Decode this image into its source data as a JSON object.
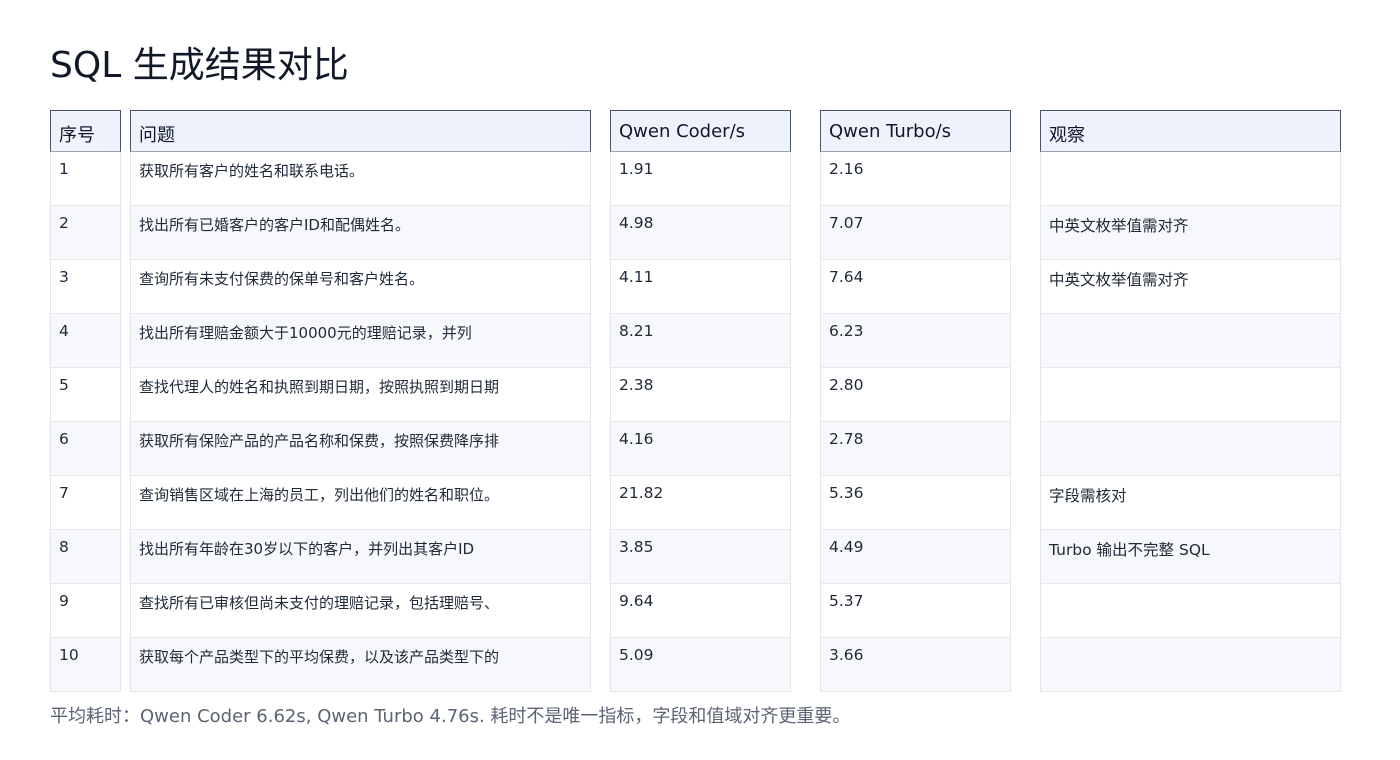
{
  "title": "SQL 生成结果对比",
  "columns": {
    "index": "序号",
    "question": "问题",
    "coder": "Qwen Coder/s",
    "turbo": "Qwen Turbo/s",
    "note": "观察"
  },
  "rows": [
    {
      "index": "1",
      "question": "获取所有客户的姓名和联系电话。",
      "coder": "1.91",
      "turbo": "2.16",
      "note": ""
    },
    {
      "index": "2",
      "question": "找出所有已婚客户的客户ID和配偶姓名。",
      "coder": "4.98",
      "turbo": "7.07",
      "note": "中英文枚举值需对齐"
    },
    {
      "index": "3",
      "question": "查询所有未支付保费的保单号和客户姓名。",
      "coder": "4.11",
      "turbo": "7.64",
      "note": "中英文枚举值需对齐"
    },
    {
      "index": "4",
      "question": "找出所有理赔金额大于10000元的理赔记录，并列",
      "coder": "8.21",
      "turbo": "6.23",
      "note": ""
    },
    {
      "index": "5",
      "question": "查找代理人的姓名和执照到期日期，按照执照到期日期",
      "coder": "2.38",
      "turbo": "2.80",
      "note": ""
    },
    {
      "index": "6",
      "question": "获取所有保险产品的产品名称和保费，按照保费降序排",
      "coder": "4.16",
      "turbo": "2.78",
      "note": ""
    },
    {
      "index": "7",
      "question": "查询销售区域在上海的员工，列出他们的姓名和职位。",
      "coder": "21.82",
      "turbo": "5.36",
      "note": "字段需核对"
    },
    {
      "index": "8",
      "question": "找出所有年龄在30岁以下的客户，并列出其客户ID",
      "coder": "3.85",
      "turbo": "4.49",
      "note": "Turbo 输出不完整 SQL"
    },
    {
      "index": "9",
      "question": "查找所有已审核但尚未支付的理赔记录，包括理赔号、",
      "coder": "9.64",
      "turbo": "5.37",
      "note": ""
    },
    {
      "index": "10",
      "question": "获取每个产品类型下的平均保费，以及该产品类型下的",
      "coder": "5.09",
      "turbo": "3.66",
      "note": ""
    }
  ],
  "footer": "平均耗时：Qwen Coder 6.62s, Qwen Turbo 4.76s. 耗时不是唯一指标，字段和值域对齐更重要。"
}
